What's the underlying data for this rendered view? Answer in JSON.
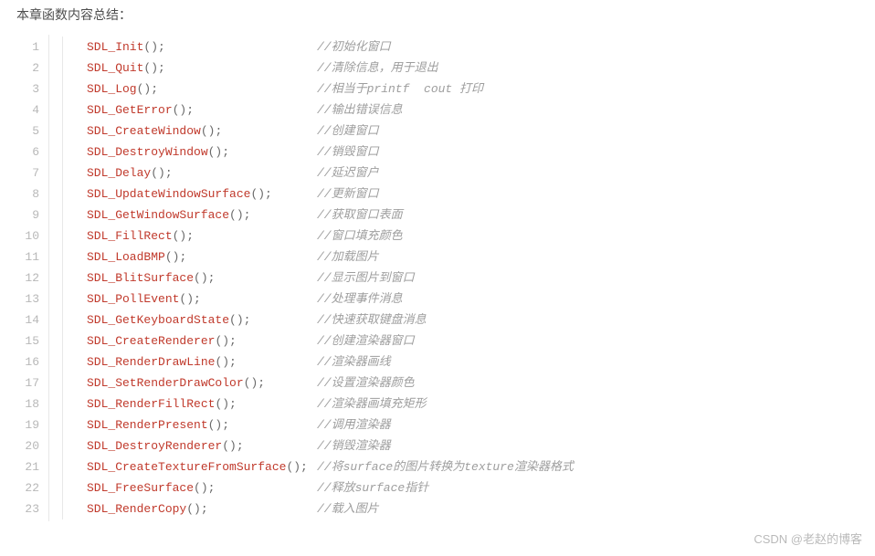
{
  "heading": "本章函数内容总结：",
  "watermark": "CSDN @老赵的博客",
  "lines": [
    {
      "fn": "SDL_Init",
      "comment": "//初始化窗口"
    },
    {
      "fn": "SDL_Quit",
      "comment": "//清除信息，用于退出"
    },
    {
      "fn": "SDL_Log",
      "comment": "//相当于printf  cout 打印"
    },
    {
      "fn": "SDL_GetError",
      "comment": "//输出错误信息"
    },
    {
      "fn": "SDL_CreateWindow",
      "comment": "//创建窗口"
    },
    {
      "fn": "SDL_DestroyWindow",
      "comment": "//销毁窗口"
    },
    {
      "fn": "SDL_Delay",
      "comment": "//延迟窗户"
    },
    {
      "fn": "SDL_UpdateWindowSurface",
      "comment": "//更新窗口"
    },
    {
      "fn": "SDL_GetWindowSurface",
      "comment": "//获取窗口表面"
    },
    {
      "fn": "SDL_FillRect",
      "comment": "//窗口填充颜色"
    },
    {
      "fn": "SDL_LoadBMP",
      "comment": "//加载图片"
    },
    {
      "fn": "SDL_BlitSurface",
      "comment": "//显示图片到窗口"
    },
    {
      "fn": "SDL_PollEvent",
      "comment": "//处理事件消息"
    },
    {
      "fn": "SDL_GetKeyboardState",
      "comment": "//快速获取键盘消息"
    },
    {
      "fn": "SDL_CreateRenderer",
      "comment": "//创建渲染器窗口"
    },
    {
      "fn": "SDL_RenderDrawLine",
      "comment": "//渲染器画线"
    },
    {
      "fn": "SDL_SetRenderDrawColor",
      "comment": "//设置渲染器颜色"
    },
    {
      "fn": "SDL_RenderFillRect",
      "comment": "//渲染器画填充矩形"
    },
    {
      "fn": "SDL_RenderPresent",
      "comment": "//调用渲染器"
    },
    {
      "fn": "SDL_DestroyRenderer",
      "comment": "//销毁渲染器"
    },
    {
      "fn": "SDL_CreateTextureFromSurface",
      "comment": "//将surface的图片转换为texture渲染器格式"
    },
    {
      "fn": "SDL_FreeSurface",
      "comment": "//释放surface指针"
    },
    {
      "fn": "SDL_RenderCopy",
      "comment": "//载入图片"
    }
  ]
}
